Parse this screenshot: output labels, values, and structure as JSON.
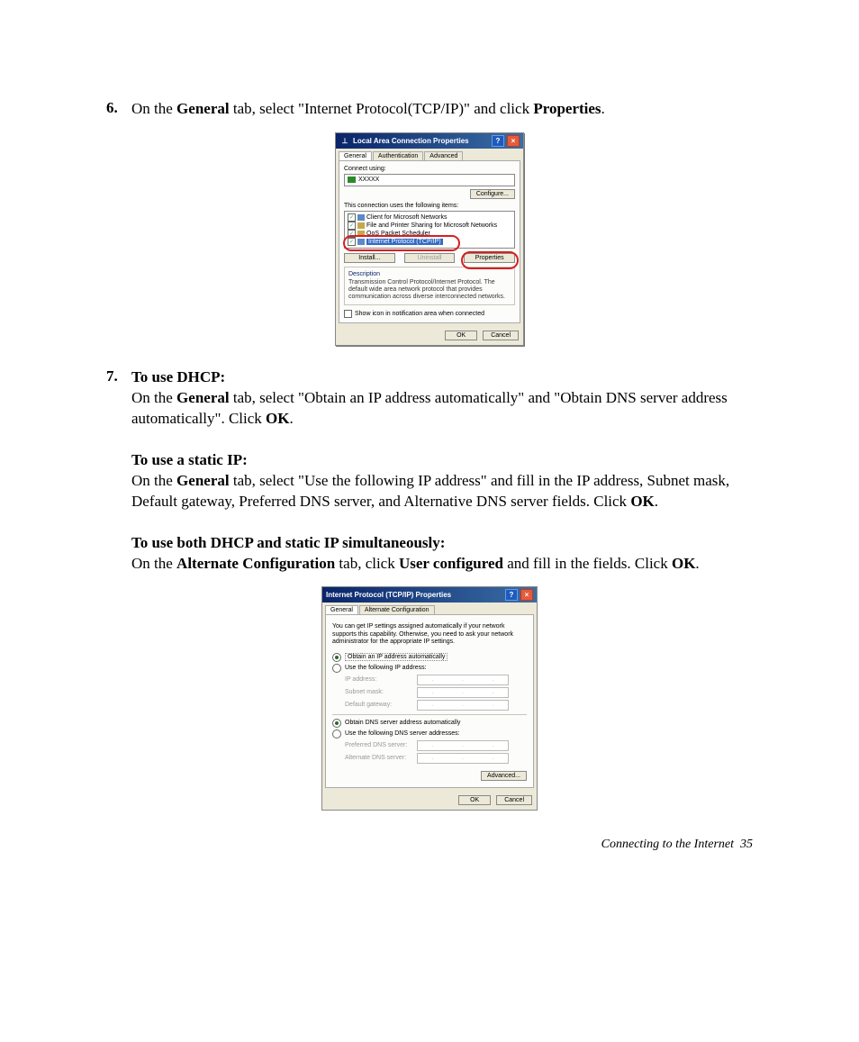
{
  "steps": {
    "s6": {
      "num": "6.",
      "t1a": "On the ",
      "t1b": "General",
      "t1c": " tab, select \"Internet Protocol(TCP/IP)\" and click ",
      "t1d": "Properties",
      "t1e": "."
    },
    "s7": {
      "num": "7.",
      "h1": "To use DHCP:",
      "p1a": "On the ",
      "p1b": "General",
      "p1c": " tab, select \"Obtain an IP address automatically\" and \"Obtain DNS server address automatically\". Click ",
      "p1d": "OK",
      "p1e": ".",
      "h2": "To use a static IP:",
      "p2a": "On the ",
      "p2b": "General",
      "p2c": " tab, select \"Use the following IP address\" and fill in the IP address, Subnet mask, Default gateway, Preferred DNS server, and Alternative DNS server fields. Click ",
      "p2d": "OK",
      "p2e": ".",
      "h3": "To use both DHCP and static IP simultaneously:",
      "p3a": "On the ",
      "p3b": "Alternate Configuration",
      "p3c": " tab, click ",
      "p3d": "User configured",
      "p3e": " and fill in the fields. Click ",
      "p3f": "OK",
      "p3g": "."
    }
  },
  "dlg1": {
    "title": "Local Area Connection Properties",
    "tabs": {
      "general": "General",
      "auth": "Authentication",
      "adv": "Advanced"
    },
    "connect_using": "Connect using:",
    "adapter": "XXXXX",
    "configure": "Configure...",
    "uses": "This connection uses the following items:",
    "items": {
      "i1": "Client for Microsoft Networks",
      "i2": "File and Printer Sharing for Microsoft Networks",
      "i3": "QoS Packet Scheduler",
      "i4": "Internet Protocol (TCP/IP)"
    },
    "install": "Install...",
    "uninstall": "Uninstall",
    "properties": "Properties",
    "desc_h": "Description",
    "desc": "Transmission Control Protocol/Internet Protocol. The default wide area network protocol that provides communication across diverse interconnected networks.",
    "show_icon": "Show icon in notification area when connected",
    "ok": "OK",
    "cancel": "Cancel"
  },
  "dlg2": {
    "title": "Internet Protocol (TCP/IP) Properties",
    "tabs": {
      "general": "General",
      "alt": "Alternate Configuration"
    },
    "intro": "You can get IP settings assigned automatically if your network supports this capability. Otherwise, you need to ask your network administrator for the appropriate IP settings.",
    "r1": "Obtain an IP address automatically",
    "r2": "Use the following IP address:",
    "f_ip": "IP address:",
    "f_mask": "Subnet mask:",
    "f_gw": "Default gateway:",
    "r3": "Obtain DNS server address automatically",
    "r4": "Use the following DNS server addresses:",
    "f_dns1": "Preferred DNS server:",
    "f_dns2": "Alternate DNS server:",
    "advanced": "Advanced...",
    "ok": "OK",
    "cancel": "Cancel"
  },
  "footer": {
    "text": "Connecting to the Internet",
    "page": "35"
  }
}
